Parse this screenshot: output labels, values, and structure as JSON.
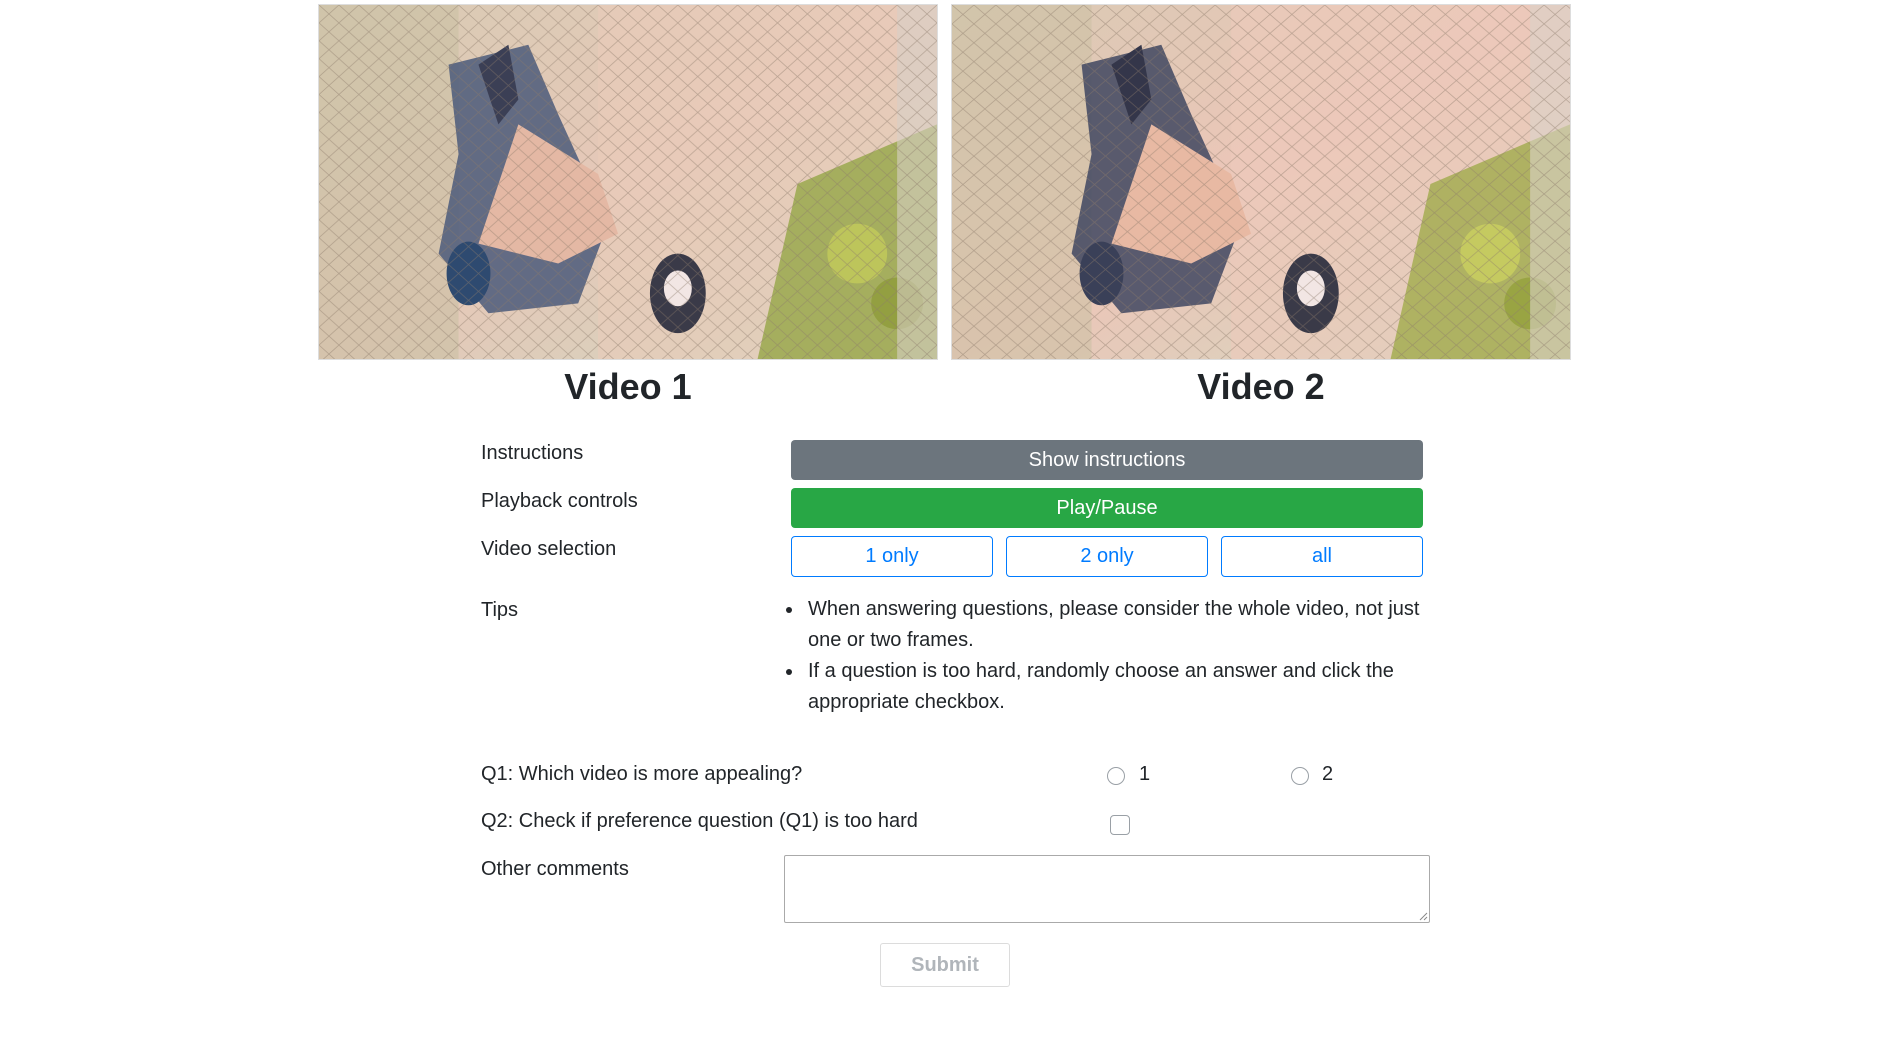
{
  "videos": [
    {
      "label": "Video 1"
    },
    {
      "label": "Video 2"
    }
  ],
  "rows": {
    "instructions_label": "Instructions",
    "playback_label": "Playback controls",
    "selection_label": "Video selection",
    "tips_label": "Tips",
    "comments_label": "Other comments"
  },
  "buttons": {
    "show_instructions": "Show instructions",
    "play_pause": "Play/Pause",
    "one_only": "1 only",
    "two_only": "2 only",
    "all": "all",
    "submit": "Submit"
  },
  "tips": [
    "When answering questions, please consider the whole video, not just one or two frames.",
    "If a question is too hard, randomly choose an answer and click the appropriate checkbox."
  ],
  "questions": {
    "q1": "Q1: Which video is more appealing?",
    "q1_options": [
      "1",
      "2"
    ],
    "q2": "Q2: Check if preference question (Q1) is too hard"
  },
  "comments": {
    "value": ""
  },
  "colors": {
    "secondary": "#6c757d",
    "success": "#28a745",
    "primary": "#007bff"
  }
}
